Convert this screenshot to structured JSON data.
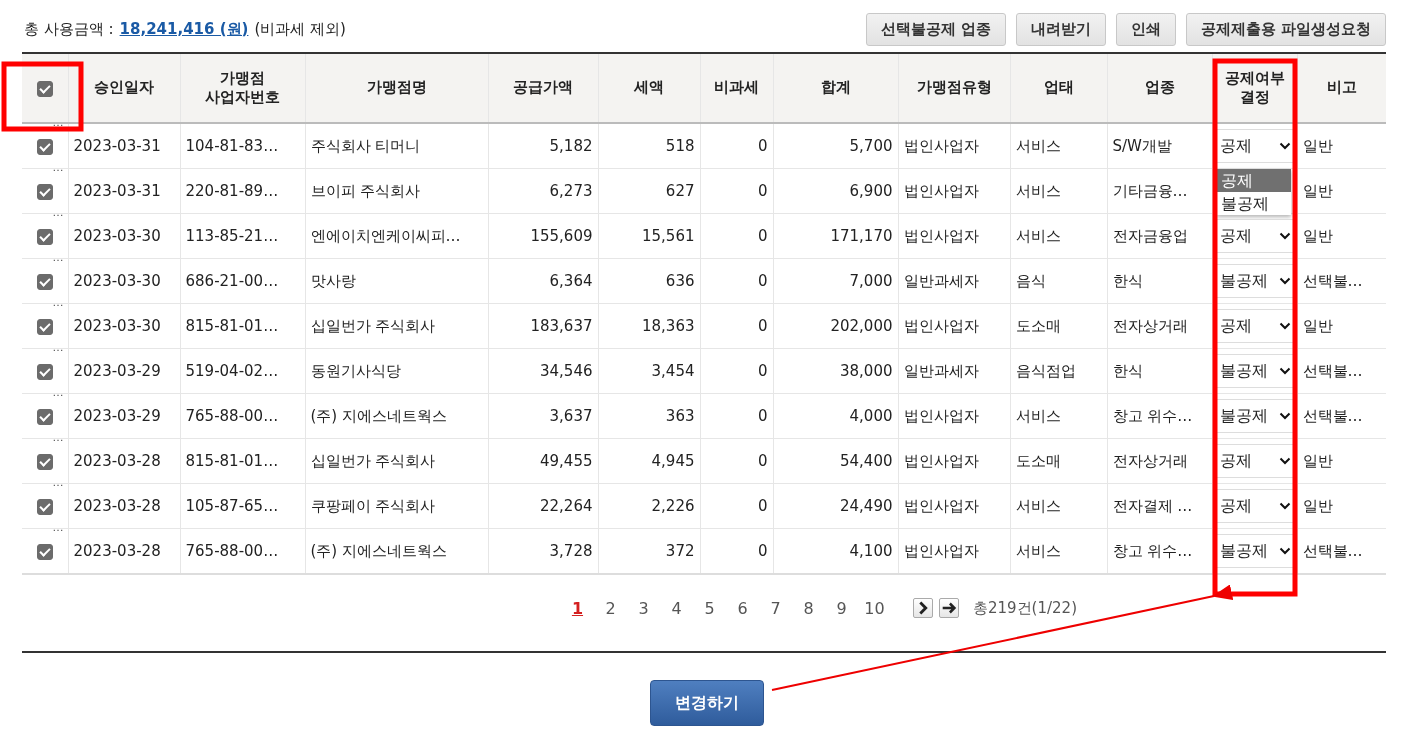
{
  "summary": {
    "label": "총 사용금액 :",
    "amount": "18,241,416 (원)",
    "note": "(비과세 제외)"
  },
  "toolbar": [
    "선택불공제 업종",
    "내려받기",
    "인쇄",
    "공제제출용 파일생성요청"
  ],
  "table": {
    "header_checked": true,
    "columns": [
      "승인일자",
      "가맹점\n사업자번호",
      "가맹점명",
      "공급가액",
      "세액",
      "비과세",
      "합계",
      "가맹점유형",
      "업태",
      "업종",
      "공제여부\n결정",
      "비고"
    ],
    "rows": [
      {
        "mark": "…",
        "checked": true,
        "date": "2023-03-31",
        "biz_no": "104-81-83…",
        "name": "주식회사 티머니",
        "supply": "5,182",
        "tax": "518",
        "nontax": "0",
        "total": "5,700",
        "type": "법인사업자",
        "business": "서비스",
        "industry": "S/W개발",
        "decision": "공제",
        "note": "일반"
      },
      {
        "mark": "…",
        "checked": true,
        "date": "2023-03-31",
        "biz_no": "220-81-89…",
        "name": "브이피 주식회사",
        "supply": "6,273",
        "tax": "627",
        "nontax": "0",
        "total": "6,900",
        "type": "법인사업자",
        "business": "서비스",
        "industry": "기타금융…",
        "options": [
          {
            "label": "공제",
            "selected": true
          },
          {
            "label": "불공제",
            "selected": false
          }
        ],
        "note": "일반"
      },
      {
        "mark": "…",
        "checked": true,
        "date": "2023-03-30",
        "biz_no": "113-85-21…",
        "name": "엔에이치엔케이씨피…",
        "supply": "155,609",
        "tax": "15,561",
        "nontax": "0",
        "total": "171,170",
        "type": "법인사업자",
        "business": "서비스",
        "industry": "전자금융업",
        "decision": "공제",
        "note": "일반"
      },
      {
        "mark": "…",
        "checked": true,
        "date": "2023-03-30",
        "biz_no": "686-21-00…",
        "name": "맛사랑",
        "supply": "6,364",
        "tax": "636",
        "nontax": "0",
        "total": "7,000",
        "type": "일반과세자",
        "business": "음식",
        "industry": "한식",
        "decision": "불공제",
        "note": "선택불…"
      },
      {
        "mark": "…",
        "checked": true,
        "date": "2023-03-30",
        "biz_no": "815-81-01…",
        "name": "십일번가 주식회사",
        "supply": "183,637",
        "tax": "18,363",
        "nontax": "0",
        "total": "202,000",
        "type": "법인사업자",
        "business": "도소매",
        "industry": "전자상거래",
        "decision": "공제",
        "note": "일반"
      },
      {
        "mark": "…",
        "checked": true,
        "date": "2023-03-29",
        "biz_no": "519-04-02…",
        "name": "동원기사식당",
        "supply": "34,546",
        "tax": "3,454",
        "nontax": "0",
        "total": "38,000",
        "type": "일반과세자",
        "business": "음식점업",
        "industry": "한식",
        "decision": "불공제",
        "note": "선택불…"
      },
      {
        "mark": "…",
        "checked": true,
        "date": "2023-03-29",
        "biz_no": "765-88-00…",
        "name": "(주) 지에스네트웍스",
        "supply": "3,637",
        "tax": "363",
        "nontax": "0",
        "total": "4,000",
        "type": "법인사업자",
        "business": "서비스",
        "industry": "창고 위수…",
        "decision": "불공제",
        "note": "선택불…"
      },
      {
        "mark": "…",
        "checked": true,
        "date": "2023-03-28",
        "biz_no": "815-81-01…",
        "name": "십일번가 주식회사",
        "supply": "49,455",
        "tax": "4,945",
        "nontax": "0",
        "total": "54,400",
        "type": "법인사업자",
        "business": "도소매",
        "industry": "전자상거래",
        "decision": "공제",
        "note": "일반"
      },
      {
        "mark": "…",
        "checked": true,
        "date": "2023-03-28",
        "biz_no": "105-87-65…",
        "name": "쿠팡페이 주식회사",
        "supply": "22,264",
        "tax": "2,226",
        "nontax": "0",
        "total": "24,490",
        "type": "법인사업자",
        "business": "서비스",
        "industry": "전자결제 …",
        "decision": "공제",
        "note": "일반"
      },
      {
        "mark": "…",
        "checked": true,
        "date": "2023-03-28",
        "biz_no": "765-88-00…",
        "name": "(주) 지에스네트웍스",
        "supply": "3,728",
        "tax": "372",
        "nontax": "0",
        "total": "4,100",
        "type": "법인사업자",
        "business": "서비스",
        "industry": "창고 위수…",
        "decision": "불공제",
        "note": "선택불…"
      }
    ]
  },
  "pagination": {
    "pages": [
      {
        "label": "1",
        "selected": true
      },
      {
        "label": "2",
        "selected": false
      },
      {
        "label": "3",
        "selected": false
      },
      {
        "label": "4",
        "selected": false
      },
      {
        "label": "5",
        "selected": false
      },
      {
        "label": "6",
        "selected": false
      },
      {
        "label": "7",
        "selected": false
      },
      {
        "label": "8",
        "selected": false
      },
      {
        "label": "9",
        "selected": false
      },
      {
        "label": "10",
        "selected": false
      }
    ],
    "total": "총219건(1/22)"
  },
  "submit": "변경하기"
}
